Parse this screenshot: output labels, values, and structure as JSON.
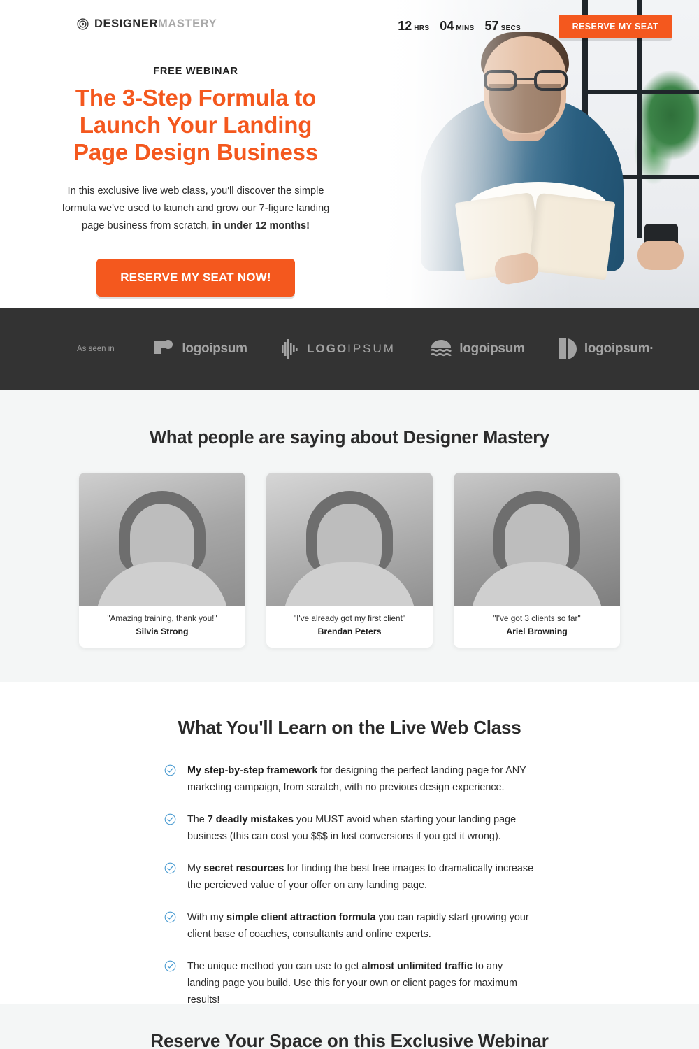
{
  "colors": {
    "accent": "#f4581e",
    "dark_band": "#333333",
    "light_section": "#f4f6f6",
    "check": "#4a9bd1"
  },
  "header": {
    "logo": {
      "icon": "target-icon",
      "primary": "DESIGNER",
      "secondary": "MASTERY"
    },
    "countdown": [
      {
        "value": "12",
        "label": "HRS"
      },
      {
        "value": "04",
        "label": "MINS"
      },
      {
        "value": "57",
        "label": "SECS"
      }
    ],
    "cta_label": "RESERVE MY SEAT"
  },
  "hero": {
    "eyebrow": "FREE WEBINAR",
    "headline_line1": "The 3-Step Formula to",
    "headline_line2": "Launch Your Landing",
    "headline_line3": "Page Design Business",
    "subcopy_part1": "In this exclusive live web class, you'll discover the simple formula we've used to launch and grow our 7-figure landing page business from scratch, ",
    "subcopy_bold": "in under 12 months!",
    "cta_label": "RESERVE MY SEAT NOW!",
    "image_alt": "man-reading-book-photo"
  },
  "logobar": {
    "as_seen_in": "As seen in",
    "logos": [
      {
        "icon": "logoipsum-square-dot-icon",
        "text": "logoipsum",
        "style": "bold"
      },
      {
        "icon": "logoipsum-bars-icon",
        "text_bold": "LOGO",
        "text_light": "IPSUM",
        "style": "spaced"
      },
      {
        "icon": "logoipsum-waves-icon",
        "text": "logoipsum",
        "style": "bold"
      },
      {
        "icon": "logoipsum-split-circle-icon",
        "text": "logoipsum·",
        "style": "bold"
      }
    ]
  },
  "testimonials": {
    "title": "What people are saying about Designer Mastery",
    "items": [
      {
        "quote": "\"Amazing training, thank you!\"",
        "author": "Silvia Strong"
      },
      {
        "quote": "\"I've already got my first client\"",
        "author": "Brendan Peters"
      },
      {
        "quote": "\"I've got 3 clients so far\"",
        "author": "Ariel Browning"
      }
    ]
  },
  "learn": {
    "title": "What You'll Learn on the Live Web Class",
    "bullets": [
      {
        "icon": "check-circle-icon",
        "lead": "",
        "bold": "My step-by-step framework",
        "rest": " for designing the perfect landing page for ANY marketing campaign, from scratch, with no previous design experience."
      },
      {
        "icon": "check-circle-icon",
        "lead": "The ",
        "bold": "7 deadly mistakes",
        "rest": " you MUST avoid when starting your landing page business (this can cost you $$$ in lost conversions if you get it wrong)."
      },
      {
        "icon": "check-circle-icon",
        "lead": "My ",
        "bold": "secret resources",
        "rest": " for finding the best free images to dramatically increase the percieved value of your offer on any landing page."
      },
      {
        "icon": "check-circle-icon",
        "lead": "With my ",
        "bold": "simple client attraction formula",
        "rest": " you can rapidly start growing your client base of coaches, consultants and online experts."
      },
      {
        "icon": "check-circle-icon",
        "lead": "The unique method you can use to get ",
        "bold": "almost unlimited traffic",
        "rest": " to any landing page you build. Use this for your own or client pages for maximum results!"
      }
    ]
  },
  "reserve": {
    "title": "Reserve Your Space on this Exclusive Webinar"
  }
}
